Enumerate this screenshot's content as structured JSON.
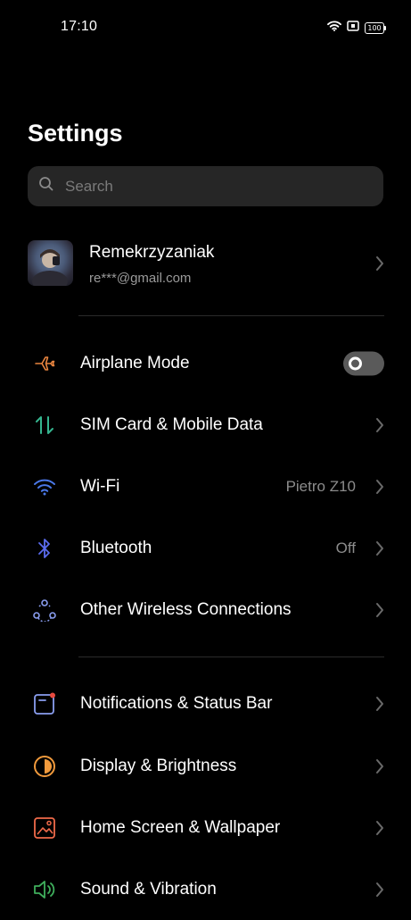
{
  "status_bar": {
    "time": "17:10",
    "battery": "100",
    "icons": [
      "wifi-icon",
      "screen-cast-icon",
      "battery-icon"
    ]
  },
  "page": {
    "title": "Settings"
  },
  "search": {
    "placeholder": "Search"
  },
  "account": {
    "name": "Remekrzyzaniak",
    "email": "re***@gmail.com"
  },
  "settings": {
    "airplane": {
      "label": "Airplane Mode",
      "enabled": false,
      "icon": "airplane-icon"
    },
    "sim": {
      "label": "SIM Card & Mobile Data",
      "icon": "mobile-data-icon"
    },
    "wifi": {
      "label": "Wi-Fi",
      "value": "Pietro Z10",
      "icon": "wifi-icon"
    },
    "bluetooth": {
      "label": "Bluetooth",
      "value": "Off",
      "icon": "bluetooth-icon"
    },
    "wireless": {
      "label": "Other Wireless Connections",
      "icon": "connections-icon"
    },
    "notifications": {
      "label": "Notifications & Status Bar",
      "icon": "notifications-icon"
    },
    "display": {
      "label": "Display & Brightness",
      "icon": "brightness-icon"
    },
    "home": {
      "label": "Home Screen & Wallpaper",
      "icon": "wallpaper-icon"
    },
    "sound": {
      "label": "Sound & Vibration",
      "icon": "speaker-icon"
    }
  },
  "colors": {
    "background": "#000000",
    "airplane_icon": "#e8843f",
    "sim_icon": "#35b58f",
    "wifi_icon": "#4a78e8",
    "bluetooth_icon": "#5b6cf0",
    "wireless_icon": "#8a9ef0",
    "notifications_icon": "#8a9ef0",
    "display_icon": "#f19a3c",
    "home_icon": "#ef6a4a",
    "sound_icon": "#3fae5c"
  }
}
